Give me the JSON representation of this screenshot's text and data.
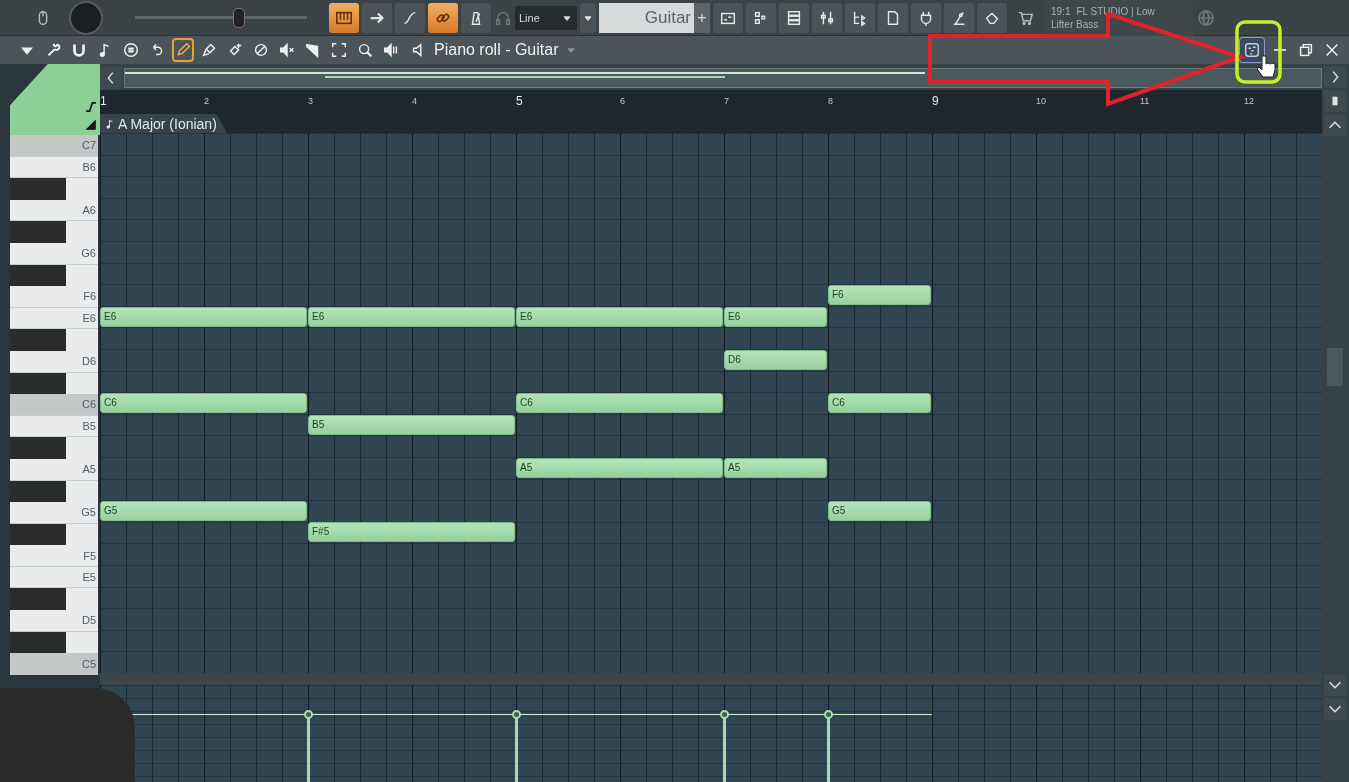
{
  "toolbar": {
    "master_slider": {
      "level": 0.6
    },
    "toggles": [
      {
        "on": true
      },
      {
        "on": false
      },
      {
        "on": false
      },
      {
        "on": true
      },
      {
        "on": false
      }
    ],
    "snap": {
      "value": "Line"
    },
    "channel": {
      "value": "Guitar",
      "add": "+"
    },
    "hint": {
      "time": "19:1",
      "line_1": "FL STUDIO | Low",
      "line_2": "Lifter Bass"
    }
  },
  "piano_roll": {
    "title": "Piano roll - Guitar",
    "tools": [
      {
        "selected": true
      },
      {
        "selected": false
      },
      {
        "selected": false
      },
      {
        "selected": false
      },
      {
        "selected": false
      },
      {
        "selected": false
      },
      {
        "selected": false
      },
      {
        "selected": false
      },
      {
        "selected": false
      }
    ],
    "ruler": [
      "1",
      "2",
      "3",
      "4",
      "5",
      "6",
      "7",
      "8",
      "9",
      "10",
      "11",
      "12"
    ],
    "scale": "A Major (Ionian)",
    "keys": [
      {
        "kind": "white",
        "label": "C7",
        "shaded": true
      },
      {
        "kind": "white",
        "label": "B6",
        "shaded": false
      },
      {
        "kind": "black"
      },
      {
        "kind": "white",
        "label": "A6",
        "shaded": false
      },
      {
        "kind": "black"
      },
      {
        "kind": "white",
        "label": "G6",
        "shaded": false
      },
      {
        "kind": "black"
      },
      {
        "kind": "white",
        "label": "F6",
        "shaded": false,
        "notes": [
          {
            "kind": "rest"
          },
          {
            "kind": "rest"
          },
          {
            "kind": "rest"
          },
          {
            "kind": "rest"
          },
          {
            "kind": "rest"
          },
          {
            "kind": "rest"
          },
          {
            "kind": "rest"
          },
          {
            "kind": "short",
            "label": "F6"
          }
        ]
      },
      {
        "kind": "white",
        "label": "E6",
        "shaded": false,
        "notes": [
          {
            "kind": "long",
            "label": "E6"
          },
          {
            "kind": "long",
            "label": "E6"
          },
          {
            "kind": "long",
            "label": "E6"
          },
          {
            "kind": "short",
            "label": "E6"
          }
        ]
      },
      {
        "kind": "black"
      },
      {
        "kind": "white",
        "label": "D6",
        "shaded": false,
        "notes": [
          {
            "kind": "rest"
          },
          {
            "kind": "rest"
          },
          {
            "kind": "rest"
          },
          {
            "kind": "rest"
          },
          {
            "kind": "rest"
          },
          {
            "kind": "rest"
          },
          {
            "kind": "short",
            "label": "D6"
          }
        ]
      },
      {
        "kind": "black"
      },
      {
        "kind": "white",
        "label": "C6",
        "shaded": true,
        "notes": [
          {
            "kind": "long",
            "label": "C6"
          },
          {
            "kind": "rest"
          },
          {
            "kind": "rest"
          },
          {
            "kind": "long",
            "label": "C6"
          },
          {
            "kind": "rest"
          },
          {
            "kind": "short",
            "label": "C6"
          }
        ]
      },
      {
        "kind": "white",
        "label": "B5",
        "shaded": false,
        "notes": [
          {
            "kind": "rest"
          },
          {
            "kind": "rest"
          },
          {
            "kind": "long",
            "label": "B5"
          }
        ]
      },
      {
        "kind": "black"
      },
      {
        "kind": "white",
        "label": "A5",
        "shaded": false,
        "notes": [
          {
            "kind": "rest"
          },
          {
            "kind": "rest"
          },
          {
            "kind": "rest"
          },
          {
            "kind": "rest"
          },
          {
            "kind": "long",
            "label": "A5"
          },
          {
            "kind": "short",
            "label": "A5"
          }
        ]
      },
      {
        "kind": "black"
      },
      {
        "kind": "white",
        "label": "G5",
        "shaded": false,
        "notes": [
          {
            "kind": "long",
            "label": "G5"
          },
          {
            "kind": "rest"
          },
          {
            "kind": "rest"
          },
          {
            "kind": "rest"
          },
          {
            "kind": "rest"
          },
          {
            "kind": "rest"
          },
          {
            "kind": "short",
            "label": "G5"
          }
        ]
      },
      {
        "kind": "black",
        "notes": [
          {
            "kind": "rest"
          },
          {
            "kind": "rest"
          },
          {
            "kind": "long",
            "label": "F#5"
          }
        ]
      },
      {
        "kind": "white",
        "label": "F5",
        "shaded": false
      },
      {
        "kind": "white",
        "label": "E5",
        "shaded": false
      },
      {
        "kind": "black"
      },
      {
        "kind": "white",
        "label": "D5",
        "shaded": false
      },
      {
        "kind": "black"
      },
      {
        "kind": "white",
        "label": "C5",
        "shaded": true
      }
    ]
  }
}
